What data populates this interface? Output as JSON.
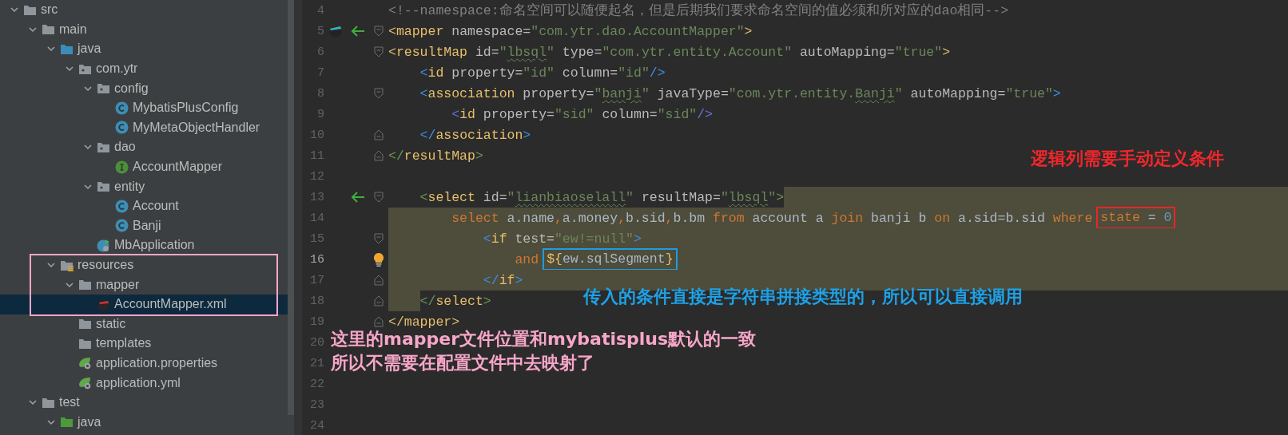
{
  "project_tree": {
    "box": {
      "color": "#f7a6c9"
    },
    "items": [
      {
        "name": "src",
        "kind": "folder",
        "expanded": true,
        "selected": false,
        "children": [
          {
            "name": "main",
            "kind": "folder",
            "expanded": true,
            "selected": false,
            "children": [
              {
                "name": "java",
                "kind": "source-folder",
                "expanded": true,
                "selected": false,
                "children": [
                  {
                    "name": "com.ytr",
                    "kind": "package",
                    "expanded": true,
                    "selected": false,
                    "children": [
                      {
                        "name": "config",
                        "kind": "package",
                        "expanded": true,
                        "selected": false,
                        "children": [
                          {
                            "name": "MybatisPlusConfig",
                            "kind": "class",
                            "selected": false
                          },
                          {
                            "name": "MyMetaObjectHandler",
                            "kind": "class",
                            "selected": false
                          }
                        ]
                      },
                      {
                        "name": "dao",
                        "kind": "package",
                        "expanded": true,
                        "selected": false,
                        "children": [
                          {
                            "name": "AccountMapper",
                            "kind": "interface",
                            "selected": false
                          }
                        ]
                      },
                      {
                        "name": "entity",
                        "kind": "package",
                        "expanded": true,
                        "selected": false,
                        "children": [
                          {
                            "name": "Account",
                            "kind": "class",
                            "selected": false
                          },
                          {
                            "name": "Banji",
                            "kind": "class",
                            "selected": false
                          }
                        ]
                      },
                      {
                        "name": "MbApplication",
                        "kind": "spring-class",
                        "selected": false
                      }
                    ]
                  }
                ]
              },
              {
                "name": "resources",
                "kind": "resources-folder",
                "expanded": true,
                "selected": false,
                "children": [
                  {
                    "name": "mapper",
                    "kind": "folder",
                    "expanded": true,
                    "selected": false,
                    "children": [
                      {
                        "name": "AccountMapper.xml",
                        "kind": "mybatis-xml",
                        "selected": true
                      }
                    ]
                  },
                  {
                    "name": "static",
                    "kind": "folder",
                    "selected": false
                  },
                  {
                    "name": "templates",
                    "kind": "folder",
                    "selected": false
                  },
                  {
                    "name": "application.properties",
                    "kind": "spring-config",
                    "selected": false
                  },
                  {
                    "name": "application.yml",
                    "kind": "spring-config",
                    "selected": false
                  }
                ]
              }
            ]
          },
          {
            "name": "test",
            "kind": "folder",
            "expanded": true,
            "selected": false,
            "children": [
              {
                "name": "java",
                "kind": "test-folder",
                "expanded": true,
                "selected": false
              }
            ]
          }
        ]
      }
    ]
  },
  "editor": {
    "lines": [
      {
        "n": "4",
        "tokens": [
          {
            "kind": "comment",
            "text": "<!--namespace:命名空间可以随便起名，但是后期我们要求命名空间的值必须和所对应的dao相同-->"
          }
        ]
      },
      {
        "n": "5",
        "markers": [
          {
            "kind": "mybatis"
          },
          {
            "kind": "arrow"
          }
        ],
        "fold": {
          "kind": "start"
        },
        "tokens": [
          {
            "kind": "bracket-outer",
            "text": "<"
          },
          {
            "kind": "tag",
            "text": "mapper"
          },
          {
            "kind": "attr",
            "text": " namespace="
          },
          {
            "kind": "string",
            "text": "\"com.ytr.dao.AccountMapper\""
          },
          {
            "kind": "bracket-outer",
            "text": ">"
          }
        ]
      },
      {
        "n": "6",
        "fold": {
          "kind": "start"
        },
        "tokens": [
          {
            "kind": "bracket-outer",
            "text": "<"
          },
          {
            "kind": "tag",
            "text": "resultMap"
          },
          {
            "kind": "attr",
            "text": " id="
          },
          {
            "kind": "string",
            "text": "\""
          },
          {
            "kind": "string",
            "text": "lbsql",
            "squiggle": true
          },
          {
            "kind": "string",
            "text": "\""
          },
          {
            "kind": "attr",
            "text": " type="
          },
          {
            "kind": "string",
            "text": "\"com.ytr.entity.Account\""
          },
          {
            "kind": "attr",
            "text": " autoMapping="
          },
          {
            "kind": "string",
            "text": "\"true\""
          },
          {
            "kind": "bracket-outer",
            "text": ">"
          }
        ]
      },
      {
        "n": "7",
        "tokens": [
          {
            "kind": "bracket-inner",
            "text": "    <"
          },
          {
            "kind": "tag",
            "text": "id"
          },
          {
            "kind": "attr",
            "text": " property="
          },
          {
            "kind": "string",
            "text": "\"id\""
          },
          {
            "kind": "attr",
            "text": " column="
          },
          {
            "kind": "string",
            "text": "\"id\""
          },
          {
            "kind": "bracket-inner",
            "text": "/>"
          }
        ]
      },
      {
        "n": "8",
        "fold": {
          "kind": "start"
        },
        "tokens": [
          {
            "kind": "bracket-inner",
            "text": "    <"
          },
          {
            "kind": "tag",
            "text": "association"
          },
          {
            "kind": "attr",
            "text": " property="
          },
          {
            "kind": "string",
            "text": "\""
          },
          {
            "kind": "string",
            "text": "banji",
            "squiggle": true
          },
          {
            "kind": "string",
            "text": "\""
          },
          {
            "kind": "attr",
            "text": " javaType="
          },
          {
            "kind": "string",
            "text": "\"com.ytr.entity."
          },
          {
            "kind": "string",
            "text": "Banji",
            "squiggle": true
          },
          {
            "kind": "string",
            "text": "\""
          },
          {
            "kind": "attr",
            "text": " autoMapping="
          },
          {
            "kind": "string",
            "text": "\"true\""
          },
          {
            "kind": "bracket-inner",
            "text": ">"
          }
        ]
      },
      {
        "n": "9",
        "tokens": [
          {
            "kind": "bracket-deep",
            "text": "        <"
          },
          {
            "kind": "tag",
            "text": "id"
          },
          {
            "kind": "attr",
            "text": " property="
          },
          {
            "kind": "string",
            "text": "\"sid\""
          },
          {
            "kind": "attr",
            "text": " column="
          },
          {
            "kind": "string",
            "text": "\"sid\""
          },
          {
            "kind": "bracket-deep",
            "text": "/>"
          }
        ]
      },
      {
        "n": "10",
        "fold": {
          "kind": "end"
        },
        "tokens": [
          {
            "kind": "bracket-inner",
            "text": "    </"
          },
          {
            "kind": "tag",
            "text": "association"
          },
          {
            "kind": "bracket-inner",
            "text": ">"
          }
        ]
      },
      {
        "n": "11",
        "fold": {
          "kind": "end"
        },
        "tokens": [
          {
            "kind": "bracket-select",
            "text": "</"
          },
          {
            "kind": "tag",
            "text": "resultMap"
          },
          {
            "kind": "bracket-select",
            "text": ">"
          }
        ]
      },
      {
        "n": "12"
      },
      {
        "n": "13",
        "markers": [
          {
            "kind": "arrow"
          }
        ],
        "fold": {
          "kind": "start"
        },
        "highlight": {
          "kind": "tail"
        },
        "tokens": [
          {
            "kind": "bracket-select",
            "text": "    <"
          },
          {
            "kind": "tag",
            "text": "select"
          },
          {
            "kind": "attr",
            "text": " id="
          },
          {
            "kind": "string",
            "text": "\""
          },
          {
            "kind": "string",
            "text": "lianbiaoselall",
            "squiggle": true
          },
          {
            "kind": "string",
            "text": "\""
          },
          {
            "kind": "attr",
            "text": " resultMap="
          },
          {
            "kind": "string",
            "text": "\""
          },
          {
            "kind": "string",
            "text": "lbsql",
            "squiggle": true
          },
          {
            "kind": "string",
            "text": "\""
          },
          {
            "kind": "bracket-select",
            "text": ">"
          }
        ]
      },
      {
        "n": "14",
        "highlight": {
          "kind": "full"
        },
        "tokens": [
          {
            "kind": "keyword",
            "text": "        select"
          },
          {
            "kind": "text",
            "text": " a.name"
          },
          {
            "kind": "keyword",
            "text": ","
          },
          {
            "kind": "text",
            "text": "a.money"
          },
          {
            "kind": "keyword",
            "text": ","
          },
          {
            "kind": "text",
            "text": "b.sid"
          },
          {
            "kind": "keyword",
            "text": ","
          },
          {
            "kind": "text",
            "text": "b.bm "
          },
          {
            "kind": "keyword",
            "text": "from"
          },
          {
            "kind": "text",
            "text": " account a "
          },
          {
            "kind": "keyword",
            "text": "join"
          },
          {
            "kind": "text",
            "text": " banji b "
          },
          {
            "kind": "keyword",
            "text": "on"
          },
          {
            "kind": "text",
            "text": " a.sid=b.sid "
          },
          {
            "kind": "keyword",
            "text": "where"
          },
          {
            "kind": "box",
            "color": "#e8262c",
            "tokens": [
              {
                "kind": "keyword",
                "text": "state"
              },
              {
                "kind": "text",
                "text": " = "
              },
              {
                "kind": "number",
                "text": "0"
              }
            ]
          }
        ]
      },
      {
        "n": "15",
        "fold": {
          "kind": "start"
        },
        "highlight": {
          "kind": "full"
        },
        "tokens": [
          {
            "kind": "bracket-inner",
            "text": "            <"
          },
          {
            "kind": "tag",
            "text": "if"
          },
          {
            "kind": "attr",
            "text": " test="
          },
          {
            "kind": "string",
            "text": "\"ew!=null\""
          },
          {
            "kind": "bracket-inner",
            "text": ">"
          }
        ]
      },
      {
        "n": "16",
        "current": true,
        "markers": [
          {
            "kind": "bulb"
          }
        ],
        "highlight": {
          "kind": "full"
        },
        "tokens": [
          {
            "kind": "keyword",
            "text": "                and"
          },
          {
            "kind": "box",
            "color": "#1e9de0",
            "tokens": [
              {
                "kind": "bracket-outer",
                "text": "${"
              },
              {
                "kind": "text",
                "text": "ew.sqlSegment"
              },
              {
                "kind": "bracket-outer",
                "text": "}"
              }
            ]
          }
        ]
      },
      {
        "n": "17",
        "fold": {
          "kind": "end"
        },
        "highlight": {
          "kind": "full"
        },
        "tokens": [
          {
            "kind": "bracket-inner",
            "text": "            </"
          },
          {
            "kind": "tag",
            "text": "if"
          },
          {
            "kind": "bracket-inner",
            "text": ">"
          }
        ]
      },
      {
        "n": "18",
        "fold": {
          "kind": "end"
        },
        "highlight": {
          "kind": "lead"
        },
        "tokens": [
          {
            "kind": "bracket-select",
            "text": "    </"
          },
          {
            "kind": "tag",
            "text": "select"
          },
          {
            "kind": "bracket-select",
            "text": ">"
          }
        ]
      },
      {
        "n": "19",
        "fold": {
          "kind": "end"
        },
        "tokens": [
          {
            "kind": "bracket-outer",
            "text": "</"
          },
          {
            "kind": "tag",
            "text": "mapper"
          },
          {
            "kind": "bracket-outer",
            "text": ">"
          }
        ]
      },
      {
        "n": "20"
      },
      {
        "n": "21"
      },
      {
        "n": "22"
      },
      {
        "n": "23"
      },
      {
        "n": "24"
      }
    ]
  },
  "annotations": [
    {
      "kind": "logic-note",
      "color": "#f0272c",
      "lines": [
        "逻辑列需要手动定义条件"
      ]
    },
    {
      "kind": "param-note",
      "color": "#1ea1e6",
      "lines": [
        "传入的条件直接是字符串拼接类型的，所以可以直接调用"
      ]
    },
    {
      "kind": "mapper-note",
      "color": "#f7a6c9",
      "lines": [
        "这里的mapper文件位置和mybatisplus默认的一致",
        "所以不需要在配置文件中去映射了"
      ]
    }
  ]
}
